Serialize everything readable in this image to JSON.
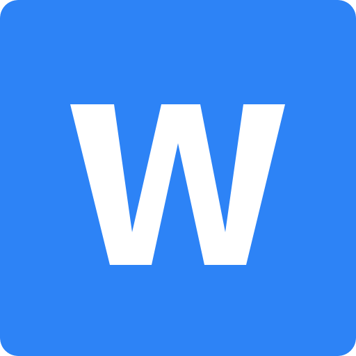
{
  "icon": {
    "semantic": "letter-w-app-icon",
    "letter": "W",
    "colors": {
      "background": "#2d83f6",
      "glyph": "#ffffff"
    }
  }
}
